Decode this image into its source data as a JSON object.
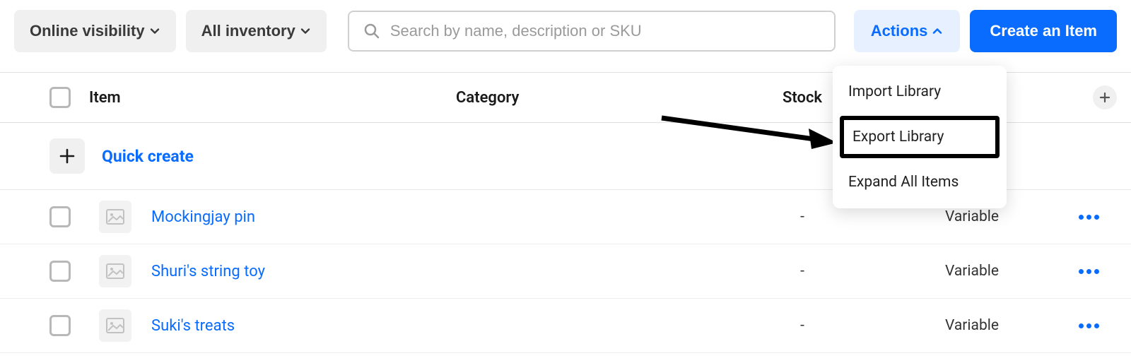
{
  "toolbar": {
    "visibility_label": "Online visibility",
    "inventory_label": "All inventory",
    "search_placeholder": "Search by name, description or SKU",
    "actions_label": "Actions",
    "create_label": "Create an Item"
  },
  "dropdown": {
    "import": "Import Library",
    "export": "Export Library",
    "expand": "Expand All Items"
  },
  "columns": {
    "item": "Item",
    "category": "Category",
    "stock": "Stock"
  },
  "quick_create": "Quick create",
  "rows": [
    {
      "name": "Mockingjay pin",
      "stock": "-",
      "price": "Variable"
    },
    {
      "name": "Shuri's string toy",
      "stock": "-",
      "price": "Variable"
    },
    {
      "name": "Suki's treats",
      "stock": "-",
      "price": "Variable"
    }
  ]
}
